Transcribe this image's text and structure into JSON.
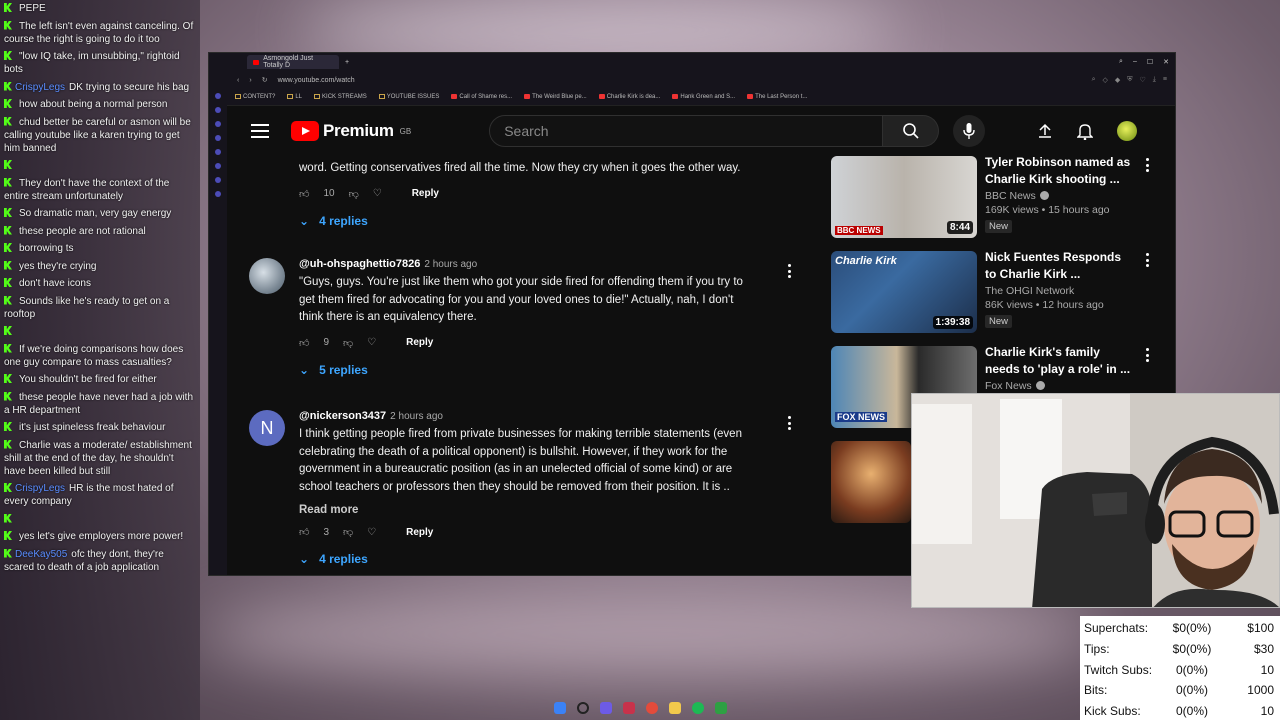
{
  "chat": [
    {
      "user": "",
      "text": "PEPE"
    },
    {
      "user": "",
      "text": "The left isn't even against canceling. Of course the right is going to do it too"
    },
    {
      "user": "",
      "text": "\"low IQ take, im unsubbing,\" rightoid bots"
    },
    {
      "user": "CrispyLegs",
      "text": "DK trying to secure his bag"
    },
    {
      "user": "",
      "text": "how about being a normal person"
    },
    {
      "user": "",
      "text": "chud better be careful or asmon will be calling youtube like a karen trying to get him banned"
    },
    {
      "user": "",
      "text": ""
    },
    {
      "user": "",
      "text": "They don't have the context of the entire stream unfortunately"
    },
    {
      "user": "",
      "text": "So dramatic man, very gay energy"
    },
    {
      "user": "",
      "text": "these people are not rational"
    },
    {
      "user": "",
      "text": "borrowing ts"
    },
    {
      "user": "",
      "text": "yes they're crying"
    },
    {
      "user": "",
      "text": "don't have icons"
    },
    {
      "user": "",
      "text": "Sounds like he's ready to get on a rooftop"
    },
    {
      "user": "",
      "text": ""
    },
    {
      "user": "",
      "text": "If we're doing comparisons how does one guy compare to mass casualties?"
    },
    {
      "user": "",
      "text": "You shouldn't be fired for either"
    },
    {
      "user": "",
      "text": "these people have never had a job with a HR department"
    },
    {
      "user": "",
      "text": "it's just spineless freak behaviour"
    },
    {
      "user": "",
      "text": "Charlie was a moderate/ establishment shill at the end of the day, he shouldn't have been killed but still"
    },
    {
      "user": "CrispyLegs",
      "text": "HR is the most hated of every company"
    },
    {
      "user": "",
      "text": ""
    },
    {
      "user": "",
      "text": "yes let's give employers more power!"
    },
    {
      "user": "DeeKay505",
      "text": "ofc they dont, they're scared to death of a job application"
    }
  ],
  "browser": {
    "tab_title": "Asmongold Just Totally D",
    "url": "www.youtube.com/watch",
    "bookmarks": [
      "CONTENT?",
      "LL",
      "KICK STREAMS",
      "YOUTUBE ISSUES",
      "Call of Shame res...",
      "The Weird Blue pe...",
      "Charlie Kirk is dea...",
      "Hank Green and S...",
      "The Last Person t..."
    ]
  },
  "youtube": {
    "logo_text": "Premium",
    "region": "GB",
    "search_placeholder": "Search"
  },
  "comments": {
    "top_partial": {
      "text": "word. Getting conservatives fired all the time. Now they cry when it goes the other way.",
      "likes": "10",
      "reply": "Reply",
      "replies": "4 replies"
    },
    "items": [
      {
        "handle": "@uh-ohspaghettio7826",
        "time": "2 hours ago",
        "lines": [
          "\"Guys, guys.  You're just like them who got your side fired for offending them if you try to",
          "get them fired for advocating for you and your loved ones to die!\"  Actually, nah, I don't",
          "think there is an equivalency there."
        ],
        "likes": "9",
        "reply": "Reply",
        "replies": "5 replies"
      },
      {
        "handle": "@nickerson3437",
        "time": "2 hours ago",
        "avatar_letter": "N",
        "lines": [
          "I think getting people fired from private businesses for making terrible statements (even",
          "celebrating the death of a political opponent) is bullshit.  However, if they work for the",
          "government in a bureaucratic position (as in an unelected official of some kind) or are",
          "school teachers or professors then they should be removed from their position.  It is .."
        ],
        "read_more": "Read more",
        "likes": "3",
        "reply": "Reply",
        "replies": "4 replies"
      }
    ]
  },
  "recommended": [
    {
      "title": "Tyler Robinson named as Charlie Kirk shooting ...",
      "channel": "BBC News",
      "stats": "169K views • 15 hours ago",
      "badge": "New",
      "duration": "8:44",
      "thumb_label": "BBC NEWS"
    },
    {
      "title": "Nick Fuentes Responds to Charlie Kirk ...",
      "channel": "The OHGI Network",
      "stats": "86K views • 12 hours ago",
      "badge": "New",
      "duration": "1:39:38",
      "thumb_label": "Charlie Kirk"
    },
    {
      "title": "Charlie Kirk's family needs to 'play a role' in ...",
      "channel": "Fox News",
      "stats": "",
      "badge": "",
      "duration": "",
      "thumb_label": "FOX NEWS"
    }
  ],
  "stats": [
    {
      "label": "Superchats:",
      "value": "$0(0%)",
      "goal": "$100"
    },
    {
      "label": "Tips:",
      "value": "$0(0%)",
      "goal": "$30"
    },
    {
      "label": "Twitch Subs:",
      "value": "0(0%)",
      "goal": "10"
    },
    {
      "label": "Bits:",
      "value": "0(0%)",
      "goal": "1000"
    },
    {
      "label": "Kick Subs:",
      "value": "0(0%)",
      "goal": "10"
    }
  ]
}
